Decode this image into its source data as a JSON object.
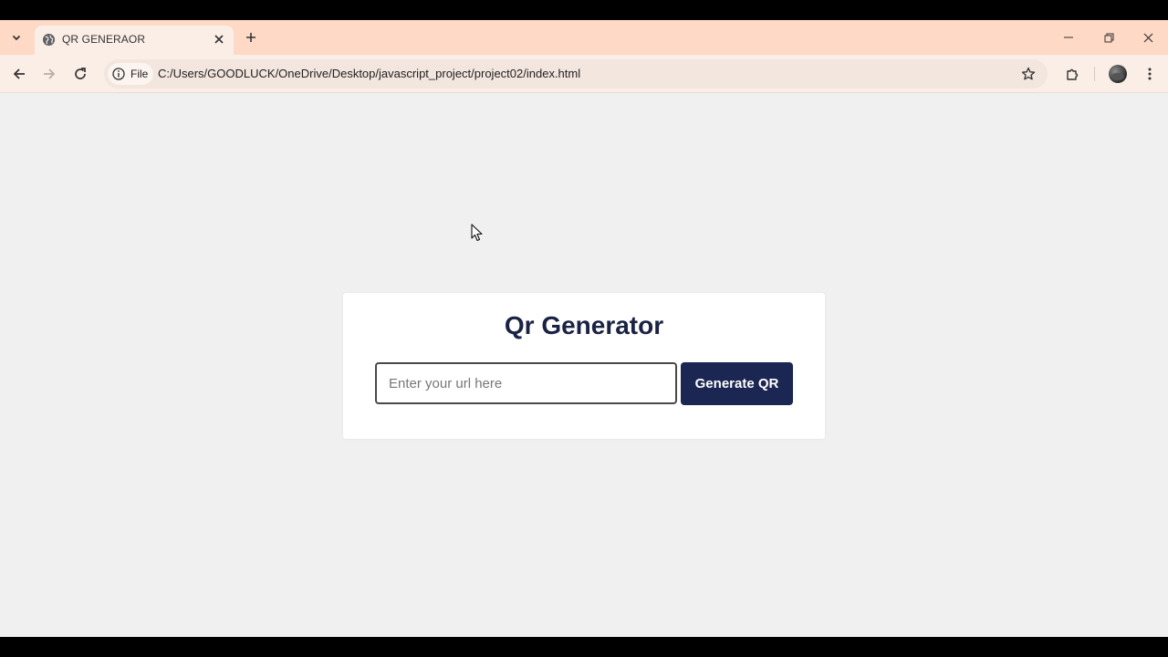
{
  "browser": {
    "tab": {
      "title": "QR GENERAOR"
    },
    "address_bar": {
      "scheme_chip": "File",
      "url": "C:/Users/GOODLUCK/OneDrive/Desktop/javascript_project/project02/index.html"
    }
  },
  "page": {
    "title": "Qr Generator",
    "url_input": {
      "value": "",
      "placeholder": "Enter your url here"
    },
    "generate_button": "Generate QR"
  },
  "colors": {
    "tab_strip": "#fdd9c6",
    "toolbar": "#fbeee6",
    "page_background": "#f1f0f0",
    "title_text": "#1b2345",
    "button_background": "#1b2652"
  }
}
